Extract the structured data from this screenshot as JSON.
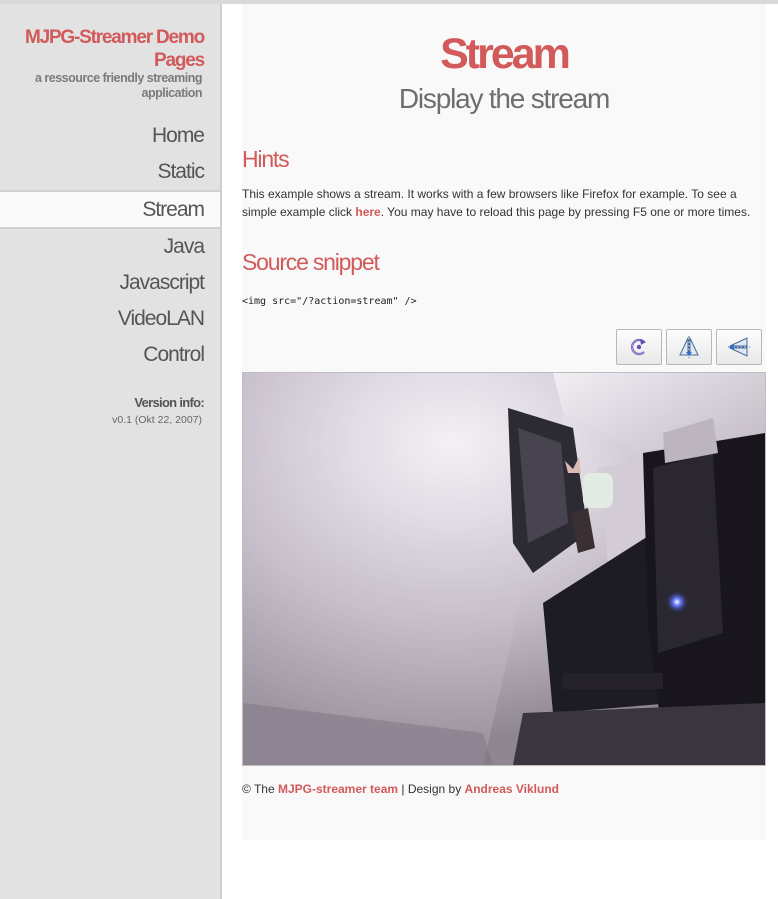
{
  "sidebar": {
    "logo": "MJPG-Streamer Demo Pages",
    "slogan": "a ressource friendly streaming application",
    "nav": [
      {
        "label": "Home"
      },
      {
        "label": "Static"
      },
      {
        "label": "Stream",
        "active": true
      },
      {
        "label": "Java"
      },
      {
        "label": "Javascript"
      },
      {
        "label": "VideoLAN"
      },
      {
        "label": "Control"
      }
    ],
    "version_label": "Version info:",
    "version_value": "v0.1 (Okt 22, 2007)"
  },
  "main": {
    "title": "Stream",
    "subtitle": "Display the stream",
    "hints_title": "Hints",
    "hints_text_before": "This example shows a stream. It works with a few browsers like Firefox for example. To see a simple example click ",
    "hints_link": "here",
    "hints_text_after": ". You may have to reload this page by pressing F5 one or more times.",
    "source_title": "Source snippet",
    "code": "<img src=\"/?action=stream\" />",
    "toolbar": [
      {
        "icon": "rotate-icon"
      },
      {
        "icon": "flip-vertical-icon"
      },
      {
        "icon": "flip-horizontal-icon"
      }
    ],
    "stream_image": "webcam stream",
    "footer": {
      "prefix": "© The ",
      "team_link": "MJPG-streamer team",
      "middle": " | Design by ",
      "designer_link": "Andreas Viklund"
    }
  },
  "colors": {
    "accent": "#d25a5a",
    "sidebar_bg": "#e2e2e2",
    "content_bg": "#f9f9f9"
  }
}
